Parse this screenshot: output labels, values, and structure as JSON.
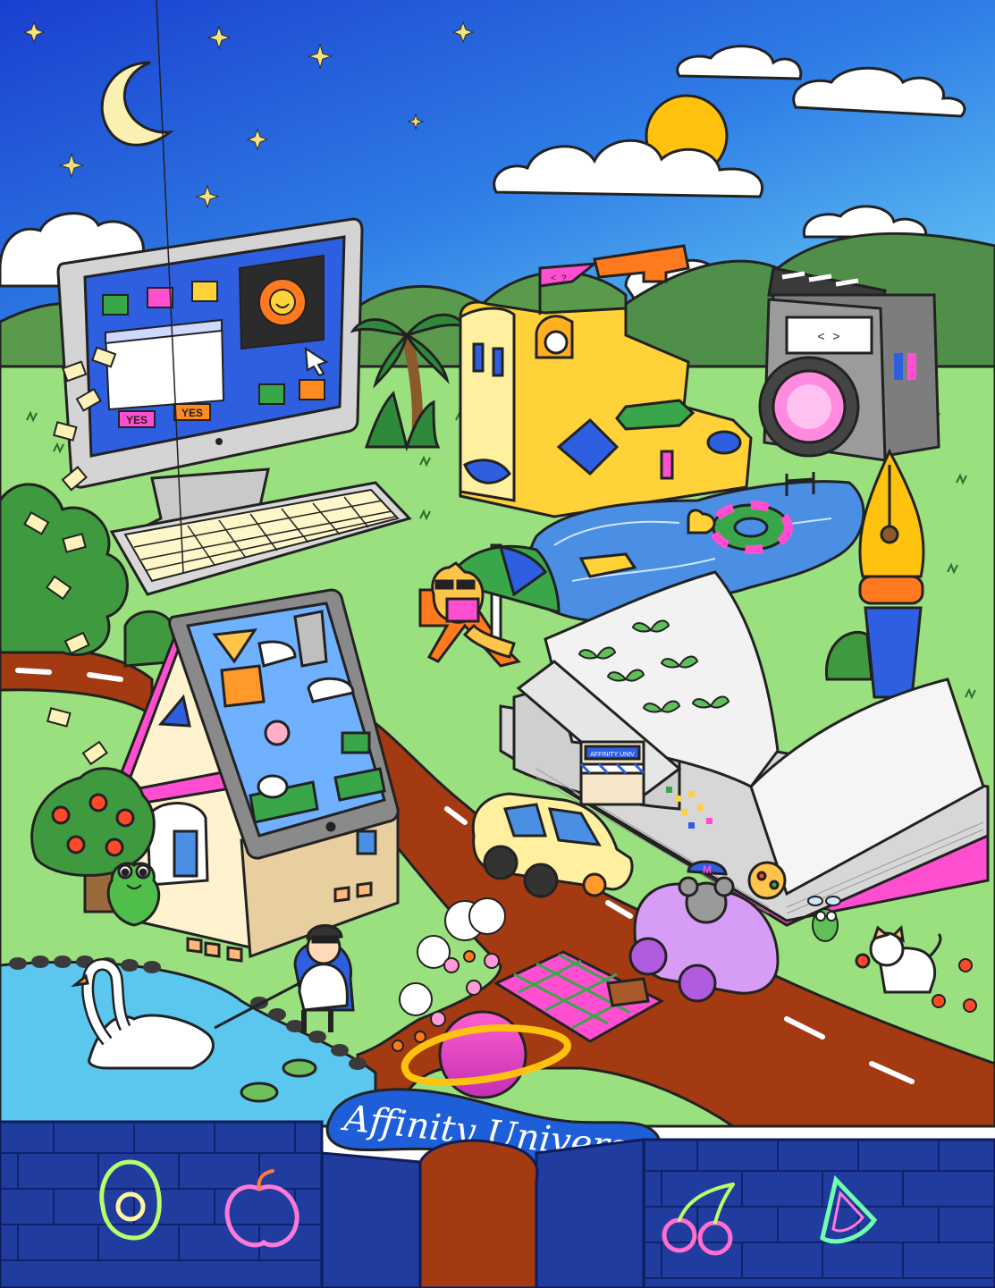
{
  "illustration": {
    "banner_title": "Affinity Universe",
    "monitor_buttons": [
      "YES",
      "YES"
    ],
    "bookstore_sign": "AFFINITY UNIV",
    "koala_cap_letter": "M",
    "flag_text": "< ?",
    "camera_label": "< >"
  },
  "colors": {
    "sky_top": "#1f4fd8",
    "sky_bottom": "#56c8f5",
    "grass": "#9be07f",
    "hills": "#4f8f4a",
    "road": "#a03a12",
    "wall": "#1f3c9e",
    "pond": "#5bc7ee",
    "banner": "#1e5ed8",
    "outline": "#1b1b1b"
  },
  "icons": [
    "moon-icon",
    "sun-icon",
    "avocado-neon-icon",
    "peach-neon-icon",
    "cherry-neon-icon",
    "watermelon-neon-icon"
  ]
}
